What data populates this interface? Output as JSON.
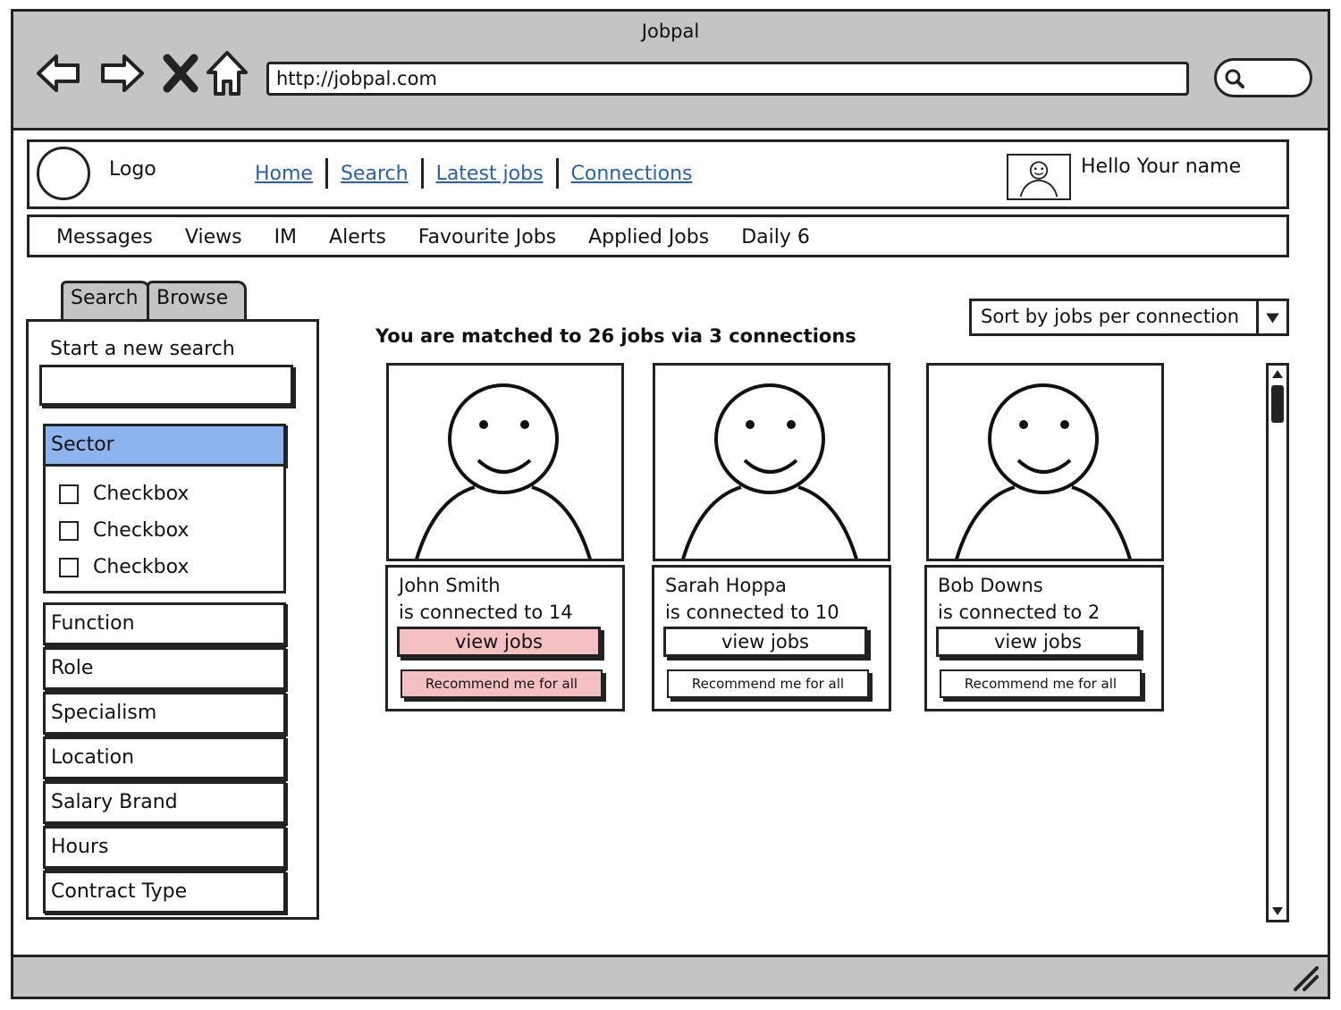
{
  "window": {
    "title": "Jobpal",
    "url": "http://jobpal.com"
  },
  "header": {
    "logo": "Logo",
    "nav": [
      "Home",
      "Search",
      "Latest jobs",
      "Connections"
    ],
    "greeting": "Hello Your name"
  },
  "subnav": [
    "Messages",
    "Views",
    "IM",
    "Alerts",
    "Favourite Jobs",
    "Applied Jobs",
    "Daily 6"
  ],
  "tabs": [
    "Search",
    "Browse"
  ],
  "sidebar": {
    "new_search_label": "Start a new search",
    "new_search_value": "",
    "sector": {
      "label": "Sector",
      "checkboxes": [
        "Checkbox",
        "Checkbox",
        "Checkbox"
      ]
    },
    "facets": [
      "Function",
      "Role",
      "Specialism",
      "Location",
      "Salary Brand",
      "Hours",
      "Contract Type"
    ]
  },
  "main": {
    "match_text": "You are matched to 26 jobs via 3 connections",
    "sort_label": "Sort by jobs per connection"
  },
  "cards": [
    {
      "name": "John Smith",
      "connection": "is connected to 14",
      "view": "view jobs",
      "recommend": "Recommend me for all",
      "highlighted": true
    },
    {
      "name": "Sarah Hoppa",
      "connection": "is connected to 10",
      "view": "view jobs",
      "recommend": "Recommend me for all",
      "highlighted": false
    },
    {
      "name": "Bob Downs",
      "connection": "is connected to 2",
      "view": "view jobs",
      "recommend": "Recommend me for all",
      "highlighted": false
    }
  ],
  "colors": {
    "chrome": "#c4c4c4",
    "link": "#2a5fb0",
    "selected_facet": "#8db4ef",
    "highlight_button": "#f4c0c3"
  },
  "icons": [
    "back-arrow-icon",
    "forward-arrow-icon",
    "stop-icon",
    "home-icon",
    "search-icon",
    "avatar-icon",
    "dropdown-arrow-icon",
    "resize-grip-icon"
  ]
}
